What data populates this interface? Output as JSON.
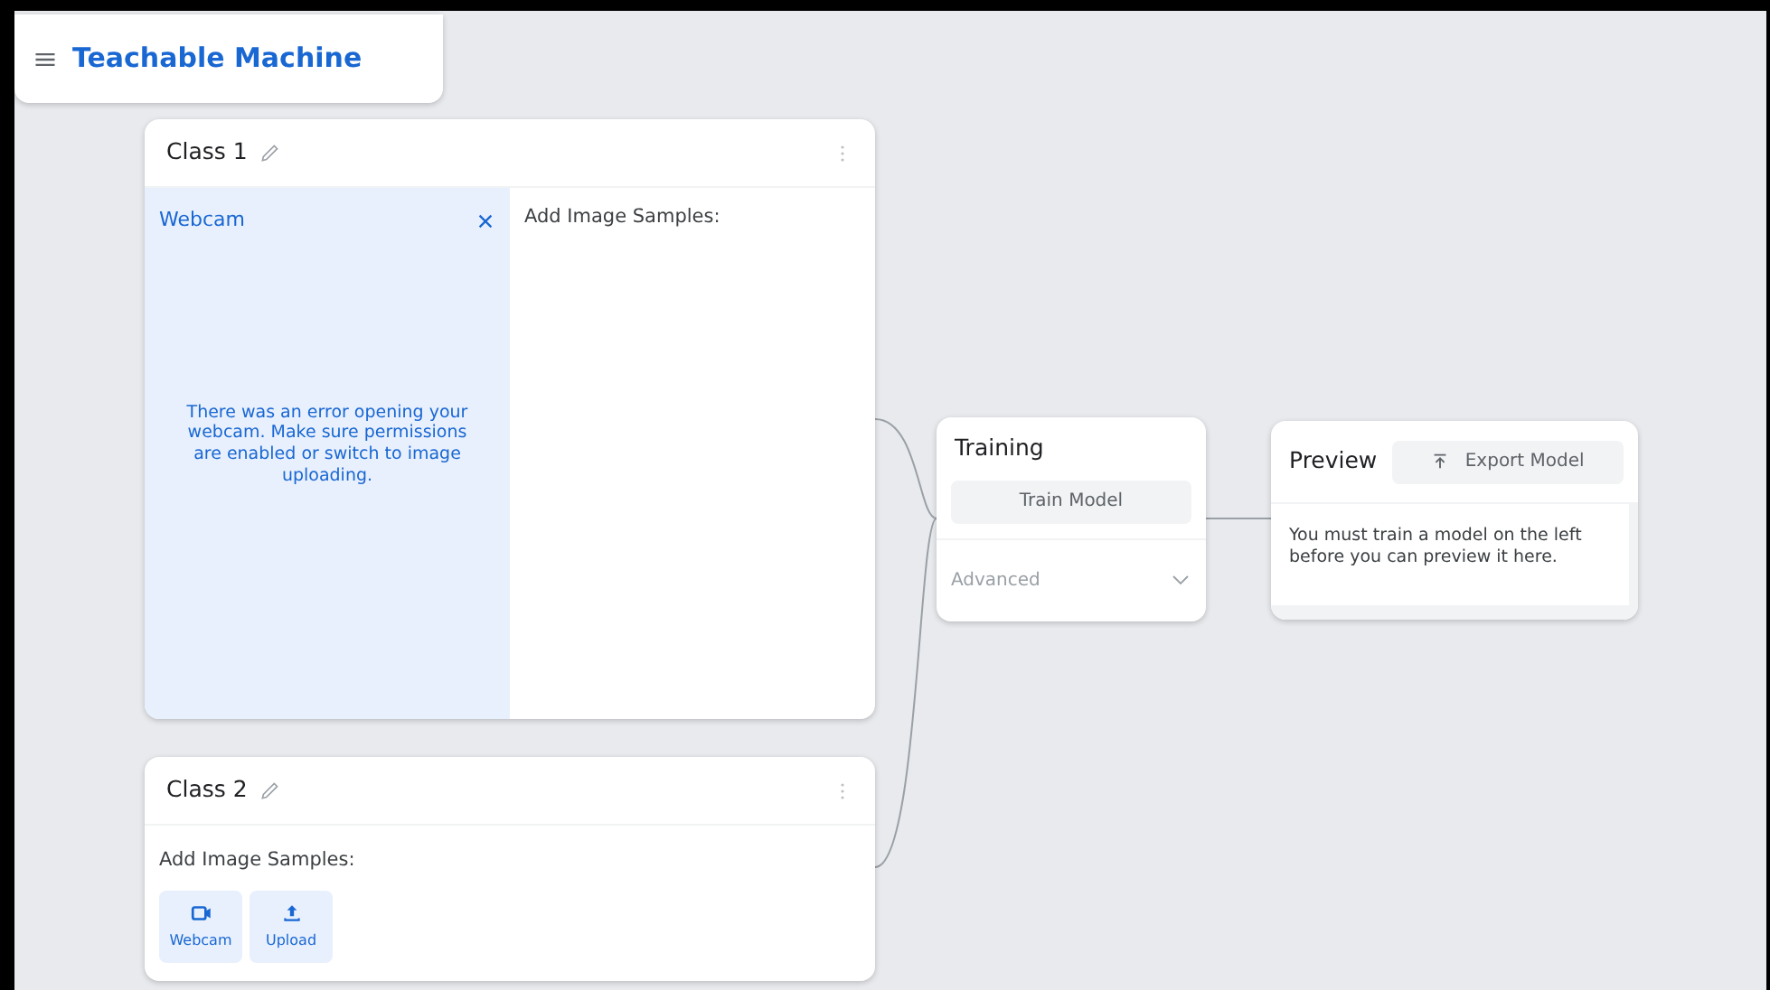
{
  "app": {
    "title": "Teachable Machine"
  },
  "classes": [
    {
      "name": "Class 1",
      "kind": "webcam_open",
      "webcam": {
        "title": "Webcam",
        "message": "There was an error opening your webcam. Make sure permissions are enabled or switch to image uploading."
      },
      "samples_label": "Add Image Samples:"
    },
    {
      "name": "Class 2",
      "kind": "collapsed",
      "samples_label": "Add Image Samples:",
      "sources": [
        {
          "kind": "webcam",
          "label": "Webcam"
        },
        {
          "kind": "upload",
          "label": "Upload"
        }
      ]
    }
  ],
  "training": {
    "title": "Training",
    "button": "Train Model",
    "advanced": "Advanced",
    "expanded": false
  },
  "preview": {
    "title": "Preview",
    "export_button": "Export Model",
    "message": "You must train a model on the left before you can preview it here."
  }
}
